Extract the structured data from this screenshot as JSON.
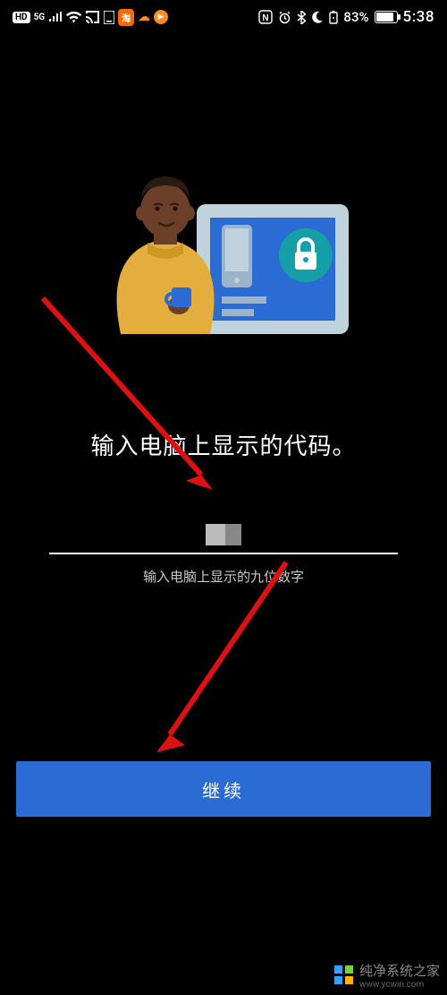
{
  "status": {
    "hd": "HD",
    "net": "5G",
    "app_tao": "淘",
    "nfc": "N",
    "battery_pct": "83%",
    "time": "5:38"
  },
  "main": {
    "heading": "输入电脑上显示的代码。",
    "input_value": "",
    "hint": "输入电脑上显示的九位数字",
    "continue_label": "继续"
  },
  "watermark": {
    "text": "纯净系统之家",
    "site": "www.ycwin.com"
  }
}
